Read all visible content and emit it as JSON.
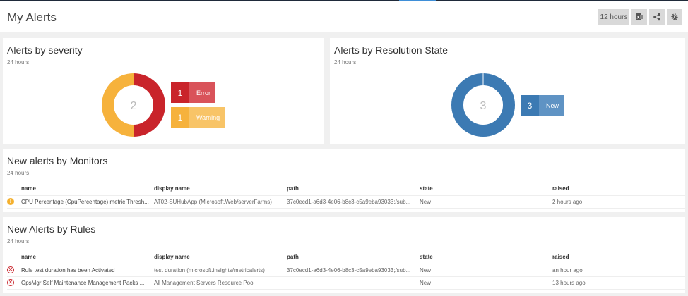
{
  "header": {
    "title": "My Alerts",
    "time_range_label": "12 hours",
    "export_icon": "excel-export-icon",
    "share_icon": "share-icon",
    "settings_icon": "gear-icon"
  },
  "severity": {
    "title": "Alerts by severity",
    "subtitle": "24 hours",
    "total": "2",
    "items": [
      {
        "count": "1",
        "label": "Error",
        "color": "#c9242b",
        "label_color": "#d9535a"
      },
      {
        "count": "1",
        "label": "Warning",
        "color": "#f6b23c",
        "label_color": "#f8c467"
      }
    ]
  },
  "resolution": {
    "title": "Alerts by Resolution State",
    "subtitle": "24 hours",
    "total": "3",
    "items": [
      {
        "count": "3",
        "label": "New",
        "color": "#3c7ab3",
        "label_color": "#5f93c4"
      }
    ]
  },
  "monitors": {
    "title": "New alerts by Monitors",
    "subtitle": "24 hours",
    "columns": [
      "name",
      "display name",
      "path",
      "state",
      "raised"
    ],
    "rows": [
      {
        "icon": "warning-icon",
        "name": "CPU Percentage (CpuPercentage) metric Thresh...",
        "display_name": "AT02-SUHubApp (Microsoft.Web/serverFarms)",
        "path": "37c0ecd1-a6d3-4e06-b8c3-c5a9eba93033;/sub...",
        "state": "New",
        "raised": "2 hours ago"
      }
    ]
  },
  "rules": {
    "title": "New Alerts by Rules",
    "subtitle": "24 hours",
    "columns": [
      "name",
      "display name",
      "path",
      "state",
      "raised"
    ],
    "rows": [
      {
        "icon": "error-icon",
        "name": "Rule test duration has been Activated",
        "display_name": "test duration (microsoft.insights/metricalerts)",
        "path": "37c0ecd1-a6d3-4e06-b8c3-c5a9eba93033;/sub...",
        "state": "New",
        "raised": "an hour ago"
      },
      {
        "icon": "error-icon",
        "name": "OpsMgr Self Maintenance Management Packs ...",
        "display_name": "All Management Servers Resource Pool",
        "path": "",
        "state": "New",
        "raised": "13 hours ago"
      }
    ]
  }
}
